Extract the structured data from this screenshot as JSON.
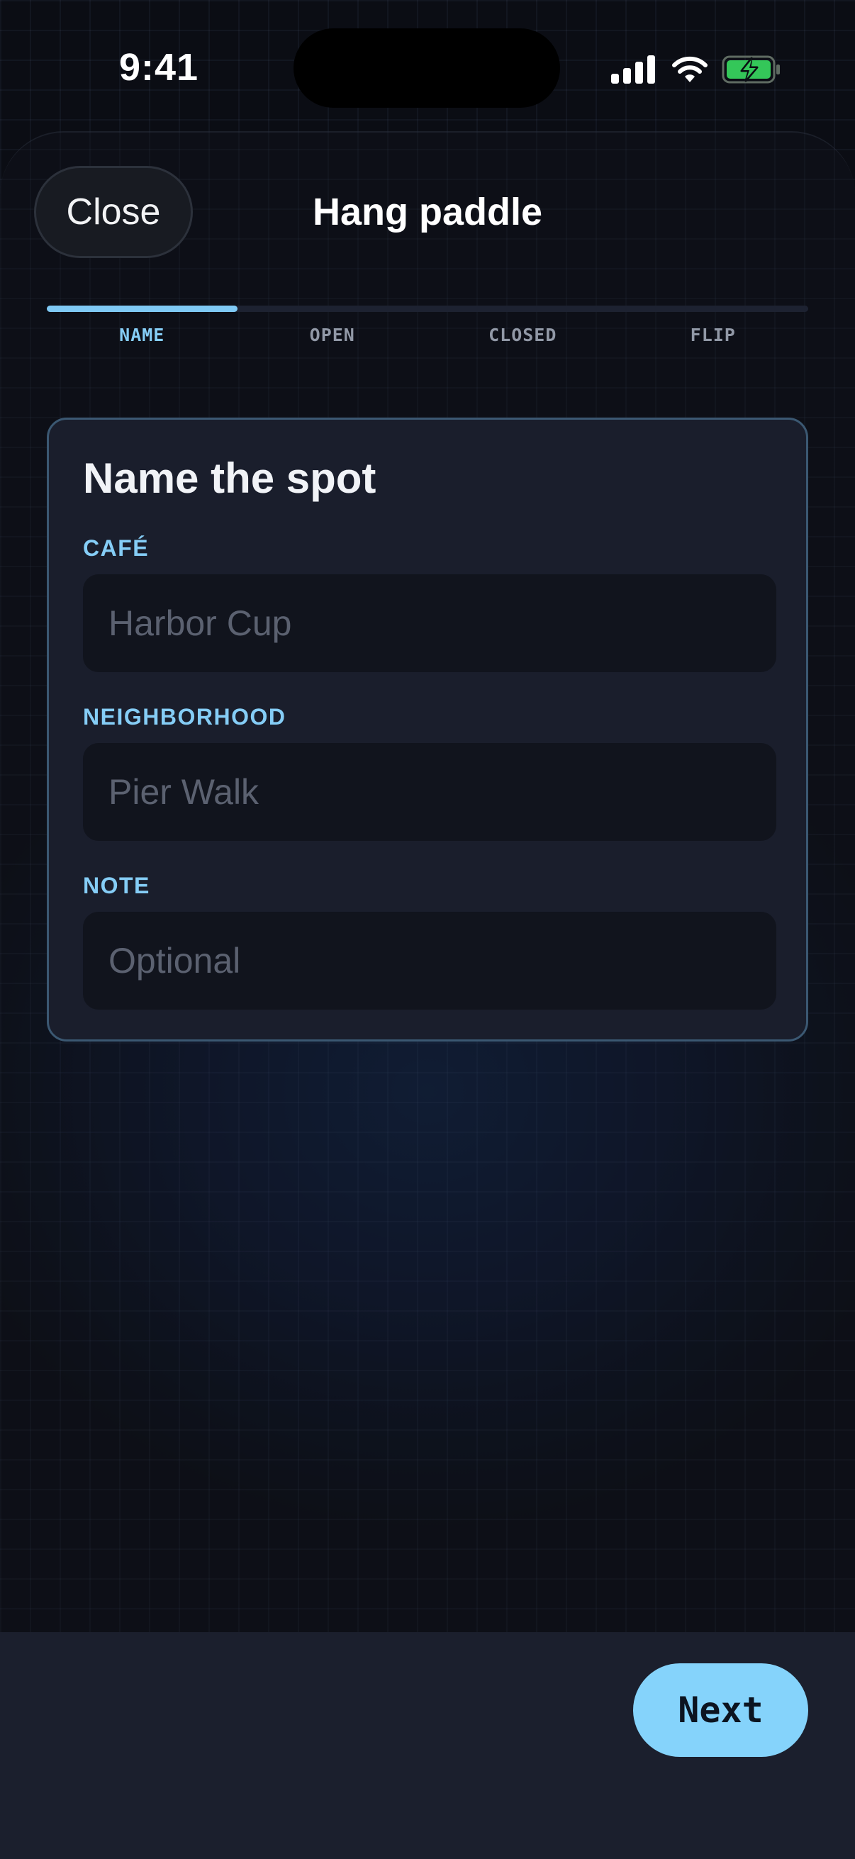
{
  "status_bar": {
    "time": "9:41",
    "icons": [
      "cellular-signal-icon",
      "wifi-icon",
      "battery-charging-icon"
    ],
    "battery_color": "#34c759"
  },
  "header": {
    "close_label": "Close",
    "title": "Hang paddle"
  },
  "progress": {
    "current_step": 1,
    "total_steps": 4,
    "steps": [
      {
        "label": "NAME",
        "active": true
      },
      {
        "label": "OPEN",
        "active": false
      },
      {
        "label": "CLOSED",
        "active": false
      },
      {
        "label": "FLIP",
        "active": false
      }
    ]
  },
  "form": {
    "title": "Name the spot",
    "fields": [
      {
        "label": "CAFÉ",
        "value": "",
        "placeholder": "Harbor Cup"
      },
      {
        "label": "NEIGHBORHOOD",
        "value": "",
        "placeholder": "Pier Walk"
      },
      {
        "label": "NOTE",
        "value": "",
        "placeholder": "Optional"
      }
    ]
  },
  "footer": {
    "next_label": "Next"
  },
  "colors": {
    "accent": "#85cdf6",
    "button": "#85d3fb",
    "card_border": "#3b5872"
  }
}
